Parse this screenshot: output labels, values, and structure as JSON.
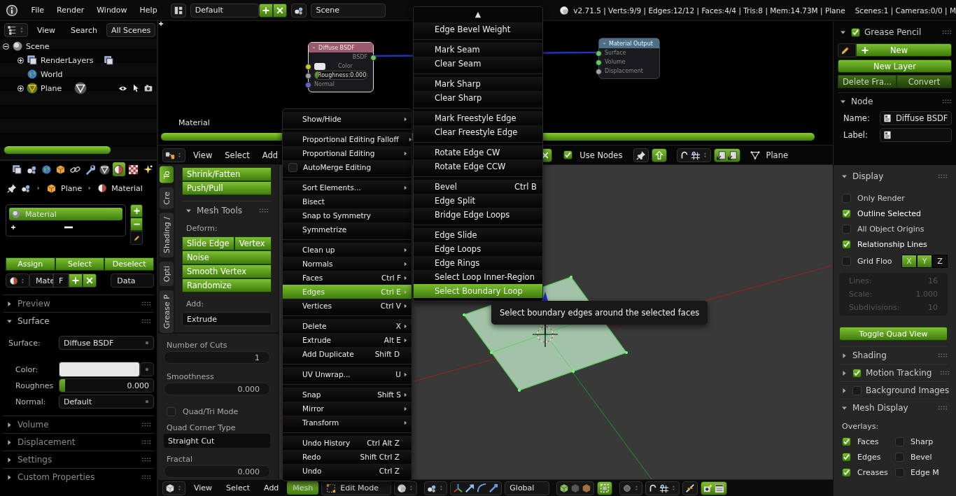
{
  "topbar": {
    "menus": [
      "File",
      "Render",
      "Window",
      "Help"
    ],
    "layout": "Default",
    "scene": "Scene",
    "stats": "v2.71.5 | Verts:9/9 | Edges:12/12 | Faces:4/4 | Tris:8 | Mem:14.73M | Plane",
    "scene_stats": "Scenes:1 | Cameras:0/0 | M"
  },
  "outliner": {
    "menus": [
      "View",
      "Search"
    ],
    "filter": "All Scenes",
    "tree": [
      {
        "label": "Scene",
        "kind": "scene",
        "expanded": true,
        "children": [
          {
            "label": "RenderLayers",
            "kind": "renderlayers",
            "expanded": false
          },
          {
            "label": "World",
            "kind": "world"
          },
          {
            "label": "Plane",
            "kind": "object",
            "expanded": false
          }
        ]
      }
    ]
  },
  "properties": {
    "tabs": [
      {
        "selected": false
      },
      {
        "selected": false
      },
      {
        "selected": false
      },
      {
        "selected": false
      },
      {
        "selected": false
      },
      {
        "selected": false
      },
      {
        "selected": false
      },
      {
        "selected": true
      },
      {
        "selected": false
      },
      {
        "selected": false
      }
    ],
    "path": [
      "Plane",
      "Material"
    ],
    "slots": [
      {
        "label": "Material",
        "selected": true
      }
    ],
    "slot_actions": [
      "Assign",
      "Select",
      "Deselect"
    ],
    "datablock": {
      "name": "Mate",
      "users": "F",
      "link": "Data"
    },
    "panels": [
      {
        "title": "Preview",
        "expanded": false
      },
      {
        "title": "Surface",
        "expanded": true,
        "fields": [
          {
            "label": "Surface:",
            "kind": "dropdown",
            "value": "Diffuse BSDF"
          },
          {
            "label": "Color:",
            "kind": "color"
          },
          {
            "label": "Roughnes",
            "kind": "slider",
            "value": "0.000",
            "level": 0
          },
          {
            "label": "Normal:",
            "kind": "dropdown",
            "value": "Default"
          }
        ]
      },
      {
        "title": "Volume",
        "expanded": false
      },
      {
        "title": "Displacement",
        "expanded": false
      },
      {
        "title": "Settings",
        "expanded": false
      },
      {
        "title": "Custom Properties",
        "expanded": false
      }
    ]
  },
  "node_editor": {
    "nodes": [
      {
        "title": "Diffuse BSDF",
        "outputs": [
          {
            "label": "BSDF",
            "color": "#63c763"
          }
        ],
        "inputs": [
          {
            "label": "Color",
            "kind": "color",
            "color": "#c7c729"
          },
          {
            "label": "Roughness:",
            "kind": "slider",
            "color": "#a1a1a1",
            "value": "0.000",
            "level": 0
          },
          {
            "label": "Normal",
            "kind": "socket",
            "color": "#6363c7"
          }
        ]
      },
      {
        "title": "Material Output",
        "inputs": [
          {
            "label": "Surface",
            "kind": "socket",
            "color": "#63c763"
          },
          {
            "label": "Volume",
            "kind": "socket",
            "color": "#63c763"
          },
          {
            "label": "Displacement",
            "kind": "socket",
            "color": "#a1a1a1"
          }
        ]
      }
    ],
    "label": "Material"
  },
  "node_header": {
    "menus": [
      "View",
      "Select",
      "Add"
    ],
    "use_nodes": {
      "label": "Use Nodes",
      "checked": true
    },
    "object": "Plane"
  },
  "node_sidebar": {
    "grease_pencil": {
      "title": "Grease Pencil",
      "checked": true,
      "expanded": true,
      "new": "New",
      "new_layer": "New Layer",
      "actions": [
        "Delete Fra...",
        "Convert"
      ]
    },
    "node_panel": {
      "title": "Node",
      "expanded": true,
      "fields": [
        {
          "label": "Name:",
          "value": "Diffuse BSDF"
        },
        {
          "label": "Label:"
        }
      ]
    }
  },
  "tool_shelf": {
    "tabs": [
      {
        "label": "To",
        "selected": true
      },
      {
        "label": "Cre",
        "selected": false
      },
      {
        "label": "Shading /",
        "selected": false
      },
      {
        "label": "Opti",
        "selected": false
      },
      {
        "label": "Grease P",
        "selected": false
      }
    ],
    "buttons": [
      "Shrink/Fatten",
      "Push/Pull"
    ],
    "panel": {
      "title": "Mesh Tools",
      "expanded": true,
      "deform_label": "Deform:",
      "deform_rows": [
        [
          "Slide Edge",
          "Vertex"
        ],
        [
          "Noise"
        ],
        [
          "Smooth Vertex"
        ],
        [
          "Randomize"
        ]
      ],
      "add_label": "Add:",
      "add_value": "Extrude"
    }
  },
  "operator": {
    "fields": [
      {
        "kind": "number",
        "label": "Number of Cuts",
        "value": "1"
      },
      {
        "kind": "number",
        "label": "Smoothness",
        "value": "0.000"
      },
      {
        "kind": "checkbox",
        "label": "Quad/Tri Mode",
        "checked": false
      },
      {
        "kind": "dropdown",
        "label": "Quad Corner Type",
        "value": "Straight Cut"
      },
      {
        "kind": "number",
        "label": "Fractal",
        "value": "0.000"
      }
    ]
  },
  "view_sidebar": {
    "display": {
      "title": "Display",
      "expanded": true,
      "toggles": [
        {
          "label": "Only Render",
          "checked": false
        },
        {
          "label": "Outline Selected",
          "checked": true
        },
        {
          "label": "All Object Origins",
          "checked": false
        },
        {
          "label": "Relationship Lines",
          "checked": true
        }
      ],
      "grid": {
        "label": "Grid Floo",
        "checked": false,
        "axes": [
          {
            "label": "X",
            "selected": true
          },
          {
            "label": "Y",
            "selected": true
          },
          {
            "label": "Z",
            "selected": false
          }
        ]
      },
      "grid_fields": [
        {
          "label": "Lines:",
          "value": "16",
          "disabled": true
        },
        {
          "label": "Scale:",
          "value": "1.000",
          "disabled": true
        },
        {
          "label": "Subdivisions:",
          "value": "10",
          "disabled": true
        }
      ],
      "quad_view": "Toggle Quad View"
    },
    "panels": [
      {
        "title": "Shading",
        "kind": "plain",
        "expanded": false
      },
      {
        "title": "Motion Tracking",
        "kind": "toggle",
        "checked": true,
        "expanded": false
      },
      {
        "title": "Background Images",
        "kind": "toggle",
        "checked": false,
        "expanded": false
      }
    ],
    "mesh_display": {
      "title": "Mesh Display",
      "expanded": true,
      "label": "Overlays:",
      "overlays": [
        {
          "label": "Faces",
          "checked": true
        },
        {
          "label": "Sharp",
          "checked": false
        },
        {
          "label": "Edges",
          "checked": true
        },
        {
          "label": "Bevel",
          "checked": false
        },
        {
          "label": "Creases",
          "checked": true
        },
        {
          "label": "Edge M",
          "checked": false
        }
      ]
    }
  },
  "view_header": {
    "menus": [
      {
        "label": "View",
        "selected": false
      },
      {
        "label": "Select",
        "selected": false
      },
      {
        "label": "Add",
        "selected": false
      },
      {
        "label": "Mesh",
        "selected": true
      }
    ],
    "mode": "Edit Mode",
    "orientation": "Global"
  },
  "mesh_menu": {
    "groups": [
      [
        {
          "label": "Show/Hide",
          "kind": "item",
          "submenu": true,
          "selected": false
        }
      ],
      [
        {
          "label": "Proportional Editing Falloff",
          "kind": "item",
          "submenu": true,
          "selected": false
        },
        {
          "label": "Proportional Editing",
          "kind": "item",
          "submenu": true,
          "selected": false
        },
        {
          "label": "AutoMerge Editing",
          "kind": "toggle",
          "checked": false,
          "submenu": false,
          "selected": false
        }
      ],
      [
        {
          "label": "Sort Elements...",
          "kind": "item",
          "submenu": true,
          "selected": false
        },
        {
          "label": "Bisect",
          "kind": "item",
          "submenu": false,
          "selected": false
        },
        {
          "label": "Snap to Symmetry",
          "kind": "item",
          "submenu": false,
          "selected": false
        },
        {
          "label": "Symmetrize",
          "kind": "item",
          "submenu": false,
          "selected": false
        }
      ],
      [
        {
          "label": "Clean up",
          "kind": "item",
          "submenu": true,
          "selected": false
        },
        {
          "label": "Normals",
          "kind": "item",
          "submenu": true,
          "selected": false
        },
        {
          "label": "Faces",
          "shortcut": "Ctrl F",
          "kind": "item",
          "submenu": true,
          "selected": false
        },
        {
          "label": "Edges",
          "shortcut": "Ctrl E",
          "kind": "item",
          "submenu": true,
          "selected": true
        },
        {
          "label": "Vertices",
          "shortcut": "Ctrl V",
          "kind": "item",
          "submenu": true,
          "selected": false
        }
      ],
      [
        {
          "label": "Delete",
          "shortcut": "X",
          "kind": "item",
          "submenu": true,
          "selected": false
        },
        {
          "label": "Extrude",
          "shortcut": "Alt E",
          "kind": "item",
          "submenu": true,
          "selected": false
        },
        {
          "label": "Add Duplicate",
          "shortcut": "Shift D",
          "kind": "item",
          "submenu": false,
          "selected": false
        }
      ],
      [
        {
          "label": "UV Unwrap...",
          "shortcut": "U",
          "kind": "item",
          "submenu": true,
          "selected": false
        }
      ],
      [
        {
          "label": "Snap",
          "shortcut": "Shift S",
          "kind": "item",
          "submenu": true,
          "selected": false
        },
        {
          "label": "Mirror",
          "kind": "item",
          "submenu": true,
          "selected": false
        },
        {
          "label": "Transform",
          "kind": "item",
          "submenu": true,
          "selected": false
        }
      ],
      [
        {
          "label": "Undo History",
          "shortcut": "Ctrl Alt Z",
          "kind": "item",
          "submenu": false,
          "selected": false
        },
        {
          "label": "Redo",
          "shortcut": "Shift Ctrl Z",
          "kind": "item",
          "submenu": false,
          "selected": false
        },
        {
          "label": "Undo",
          "shortcut": "Ctrl Z",
          "kind": "item",
          "submenu": false,
          "selected": false
        }
      ]
    ]
  },
  "edges_menu": {
    "scroll": "▲",
    "groups": [
      [
        {
          "label": "Edge Bevel Weight",
          "selected": false
        }
      ],
      [
        {
          "label": "Mark Seam",
          "selected": false
        },
        {
          "label": "Clear Seam",
          "selected": false
        }
      ],
      [
        {
          "label": "Mark Sharp",
          "selected": false
        },
        {
          "label": "Clear Sharp",
          "selected": false
        }
      ],
      [
        {
          "label": "Mark Freestyle Edge",
          "selected": false
        },
        {
          "label": "Clear Freestyle Edge",
          "selected": false
        }
      ],
      [
        {
          "label": "Rotate Edge CW",
          "selected": false
        },
        {
          "label": "Rotate Edge CCW",
          "selected": false
        }
      ],
      [
        {
          "label": "Bevel",
          "shortcut": "Ctrl B",
          "selected": false
        },
        {
          "label": "Edge Split",
          "selected": false
        },
        {
          "label": "Bridge Edge Loops",
          "selected": false
        }
      ],
      [
        {
          "label": "Edge Slide",
          "selected": false
        },
        {
          "label": "Edge Loops",
          "selected": false
        },
        {
          "label": "Edge Rings",
          "selected": false
        },
        {
          "label": "Select Loop Inner-Region",
          "selected": false
        },
        {
          "label": "Select Boundary Loop",
          "selected": true
        }
      ]
    ]
  },
  "tooltip": "Select boundary edges around the selected faces"
}
